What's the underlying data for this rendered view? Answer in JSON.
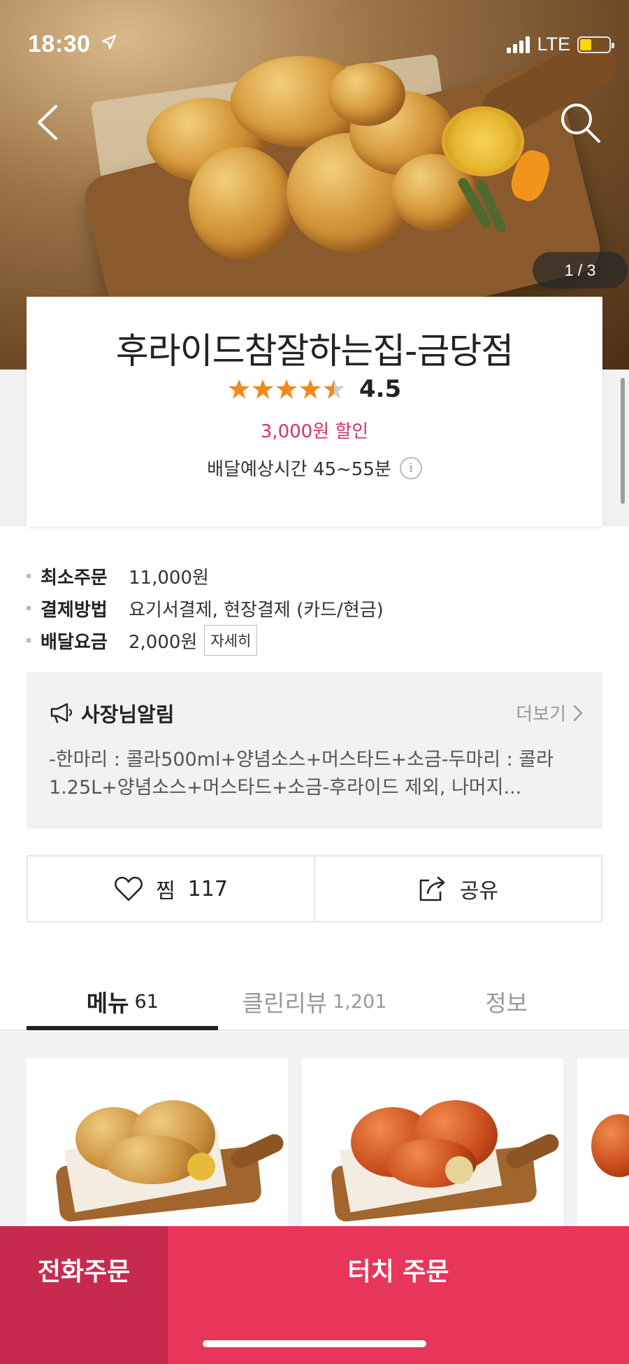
{
  "status_bar": {
    "time": "18:30",
    "network": "LTE"
  },
  "hero": {
    "pager": "1 / 3"
  },
  "store": {
    "name": "후라이드참잘하는집-금당점",
    "rating": 4.5,
    "rating_text": "4.5",
    "discount": "3,000원 할인",
    "delivery_time": "배달예상시간 45~55분",
    "accent_color": "#d6335f"
  },
  "info": [
    {
      "key": "최소주문",
      "value": "11,000원"
    },
    {
      "key": "결제방법",
      "value": "요기서결제, 현장결제 (카드/현금)"
    },
    {
      "key": "배달요금",
      "value": "2,000원",
      "detail": "자세히"
    }
  ],
  "notice": {
    "title": "사장님알림",
    "more": "더보기",
    "body": "-한마리 : 콜라500ml+양념소스+머스타드+소금-두마리 : 콜라1.25L+양념소스+머스타드+소금-후라이드 제외, 나머지..."
  },
  "actions": {
    "favorite_label": "찜",
    "favorite_count": "117",
    "share_label": "공유"
  },
  "tabs": [
    {
      "label": "메뉴",
      "count": "61",
      "active": true
    },
    {
      "label": "클린리뷰",
      "count": "1,201",
      "active": false
    },
    {
      "label": "정보",
      "count": "",
      "active": false
    }
  ],
  "bottom_bar": {
    "call_label": "전화주문",
    "order_label": "터치 주문",
    "primary_color": "#e8355a"
  }
}
